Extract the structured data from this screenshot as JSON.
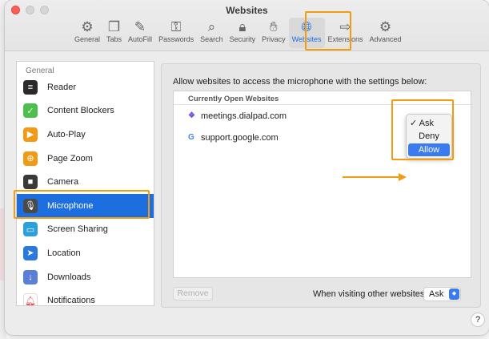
{
  "window": {
    "title": "Websites"
  },
  "toolbar": {
    "tabs": [
      {
        "label": "General",
        "icon": "gear-icon",
        "glyph": "⚙"
      },
      {
        "label": "Tabs",
        "icon": "tabs-icon",
        "glyph": "❐"
      },
      {
        "label": "AutoFill",
        "icon": "pencil-field-icon",
        "glyph": "✎"
      },
      {
        "label": "Passwords",
        "icon": "key-icon",
        "glyph": "⚿"
      },
      {
        "label": "Search",
        "icon": "search-icon",
        "glyph": "⌕"
      },
      {
        "label": "Security",
        "icon": "lock-icon",
        "glyph": "🔒︎"
      },
      {
        "label": "Privacy",
        "icon": "hand-icon",
        "glyph": "✋︎"
      },
      {
        "label": "Websites",
        "icon": "globe-icon",
        "glyph": "🌐︎"
      },
      {
        "label": "Extensions",
        "icon": "puzzle-icon",
        "glyph": "⇨"
      },
      {
        "label": "Advanced",
        "icon": "gears-icon",
        "glyph": "⚙"
      }
    ],
    "active": "Websites"
  },
  "sidebar": {
    "header": "General",
    "items": [
      {
        "label": "Reader",
        "icon": "reader-icon",
        "color": "#2b2b2b",
        "glyph": "≡"
      },
      {
        "label": "Content Blockers",
        "icon": "checkmark-shield-icon",
        "color": "#4cc04c",
        "glyph": "✓"
      },
      {
        "label": "Auto-Play",
        "icon": "play-icon",
        "color": "#f29a13",
        "glyph": "▶"
      },
      {
        "label": "Page Zoom",
        "icon": "zoom-icon",
        "color": "#f29a13",
        "glyph": "⊕"
      },
      {
        "label": "Camera",
        "icon": "camera-icon",
        "color": "#3a3a3a",
        "glyph": "■"
      },
      {
        "label": "Microphone",
        "icon": "microphone-icon",
        "color": "#4a4a4a",
        "glyph": "🎙︎"
      },
      {
        "label": "Screen Sharing",
        "icon": "screen-sharing-icon",
        "color": "#2aa0e0",
        "glyph": "▭"
      },
      {
        "label": "Location",
        "icon": "location-arrow-icon",
        "color": "#2a78e0",
        "glyph": "➤"
      },
      {
        "label": "Downloads",
        "icon": "download-icon",
        "color": "#5a7fd8",
        "glyph": "↓"
      },
      {
        "label": "Notifications",
        "icon": "bell-icon",
        "color": "#ffffff",
        "glyph": "🔔︎"
      }
    ],
    "selected": "Microphone"
  },
  "main": {
    "description": "Allow websites to access the microphone with the settings below:",
    "list_header": "Currently Open Websites",
    "sites": [
      {
        "name": "meetings.dialpad.com",
        "icon": "dialpad-icon",
        "glyph": "❖",
        "color": "#7b4ddf"
      },
      {
        "name": "support.google.com",
        "icon": "google-icon",
        "glyph": "G",
        "color": "#4285f4"
      }
    ],
    "popup": {
      "options": [
        "Ask",
        "Deny",
        "Allow"
      ],
      "checked": "Ask",
      "highlighted": "Allow"
    },
    "remove_label": "Remove",
    "other_label": "When visiting other websites:",
    "other_value": "Ask"
  },
  "help_label": "?",
  "colors": {
    "accent": "#1d6fe0",
    "annotation": "#f39c12"
  }
}
